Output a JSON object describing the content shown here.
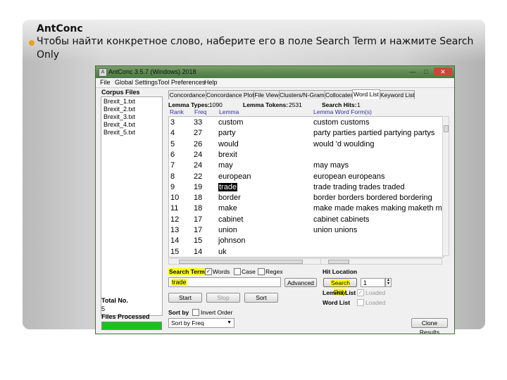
{
  "slide": {
    "title": "AntConc",
    "bullet": "Чтобы найти конкретное слово, наберите его в поле Search Term и нажмите Search Only"
  },
  "window": {
    "title": "AntConc 3.5.7 (Windows) 2018",
    "menu": [
      "File",
      "Global Settings",
      "Tool Preferences",
      "Help"
    ]
  },
  "corpus": {
    "header": "Corpus Files",
    "files": [
      "Brexit_1.txt",
      "Brexit_2.txt",
      "Brexit_3.txt",
      "Brexit_4.txt",
      "Brexit_5.txt"
    ],
    "total_label": "Total No.",
    "total_value": "5",
    "files_processed_label": "Files Processed",
    "progress": 1.0
  },
  "tabs": [
    "Concordance",
    "Concordance Plot",
    "File View",
    "Clusters/N-Grams",
    "Collocates",
    "Word List",
    "Keyword List"
  ],
  "active_tab": "Word List",
  "stats": {
    "lemma_types_label": "Lemma Types:",
    "lemma_types_value": "1090",
    "lemma_tokens_label": "Lemma Tokens:",
    "lemma_tokens_value": "2531",
    "search_hits_label": "Search Hits:",
    "search_hits_value": "1"
  },
  "columns": [
    "Rank",
    "Freq",
    "Lemma",
    "Lemma Word Form(s)"
  ],
  "rows": [
    {
      "rank": "3",
      "freq": "33",
      "lemma": "custom",
      "forms": "custom customs"
    },
    {
      "rank": "4",
      "freq": "27",
      "lemma": "party",
      "forms": "party parties partied partying partys"
    },
    {
      "rank": "5",
      "freq": "26",
      "lemma": "would",
      "forms": "would 'd woulding"
    },
    {
      "rank": "6",
      "freq": "24",
      "lemma": "brexit",
      "forms": ""
    },
    {
      "rank": "7",
      "freq": "24",
      "lemma": "may",
      "forms": "may mays"
    },
    {
      "rank": "8",
      "freq": "22",
      "lemma": "european",
      "forms": "european europeans"
    },
    {
      "rank": "9",
      "freq": "19",
      "lemma": "trade",
      "forms": "trade trading trades traded",
      "selected": true
    },
    {
      "rank": "10",
      "freq": "18",
      "lemma": "border",
      "forms": "border borders bordered bordering"
    },
    {
      "rank": "11",
      "freq": "18",
      "lemma": "make",
      "forms": "make made makes making maketh mak"
    },
    {
      "rank": "12",
      "freq": "17",
      "lemma": "cabinet",
      "forms": "cabinet cabinets"
    },
    {
      "rank": "13",
      "freq": "17",
      "lemma": "union",
      "forms": "union unions"
    },
    {
      "rank": "14",
      "freq": "15",
      "lemma": "johnson",
      "forms": ""
    },
    {
      "rank": "15",
      "freq": "14",
      "lemma": "uk",
      "forms": ""
    }
  ],
  "search": {
    "term_label": "Search Term",
    "words_label": "Words",
    "case_label": "Case",
    "regex_label": "Regex",
    "term_value": "trade",
    "advanced_label": "Advanced",
    "start_label": "Start",
    "stop_label": "Stop",
    "sort_label": "Sort",
    "hit_location_label": "Hit Location",
    "search_only_label": "Search Only",
    "hit_location_value": "1",
    "lemma_list_label": "Lemma List",
    "word_list_label": "Word List",
    "loaded_label": "Loaded",
    "sort_by_label": "Sort by",
    "invert_order_label": "Invert Order",
    "sort_by_value": "Sort by Freq",
    "clone_results_label": "Clone Results"
  },
  "colors": {
    "highlight": "#ffff1f",
    "title_bar": "#5c8850",
    "progress": "#19c419",
    "bullet": "#e8a020"
  }
}
